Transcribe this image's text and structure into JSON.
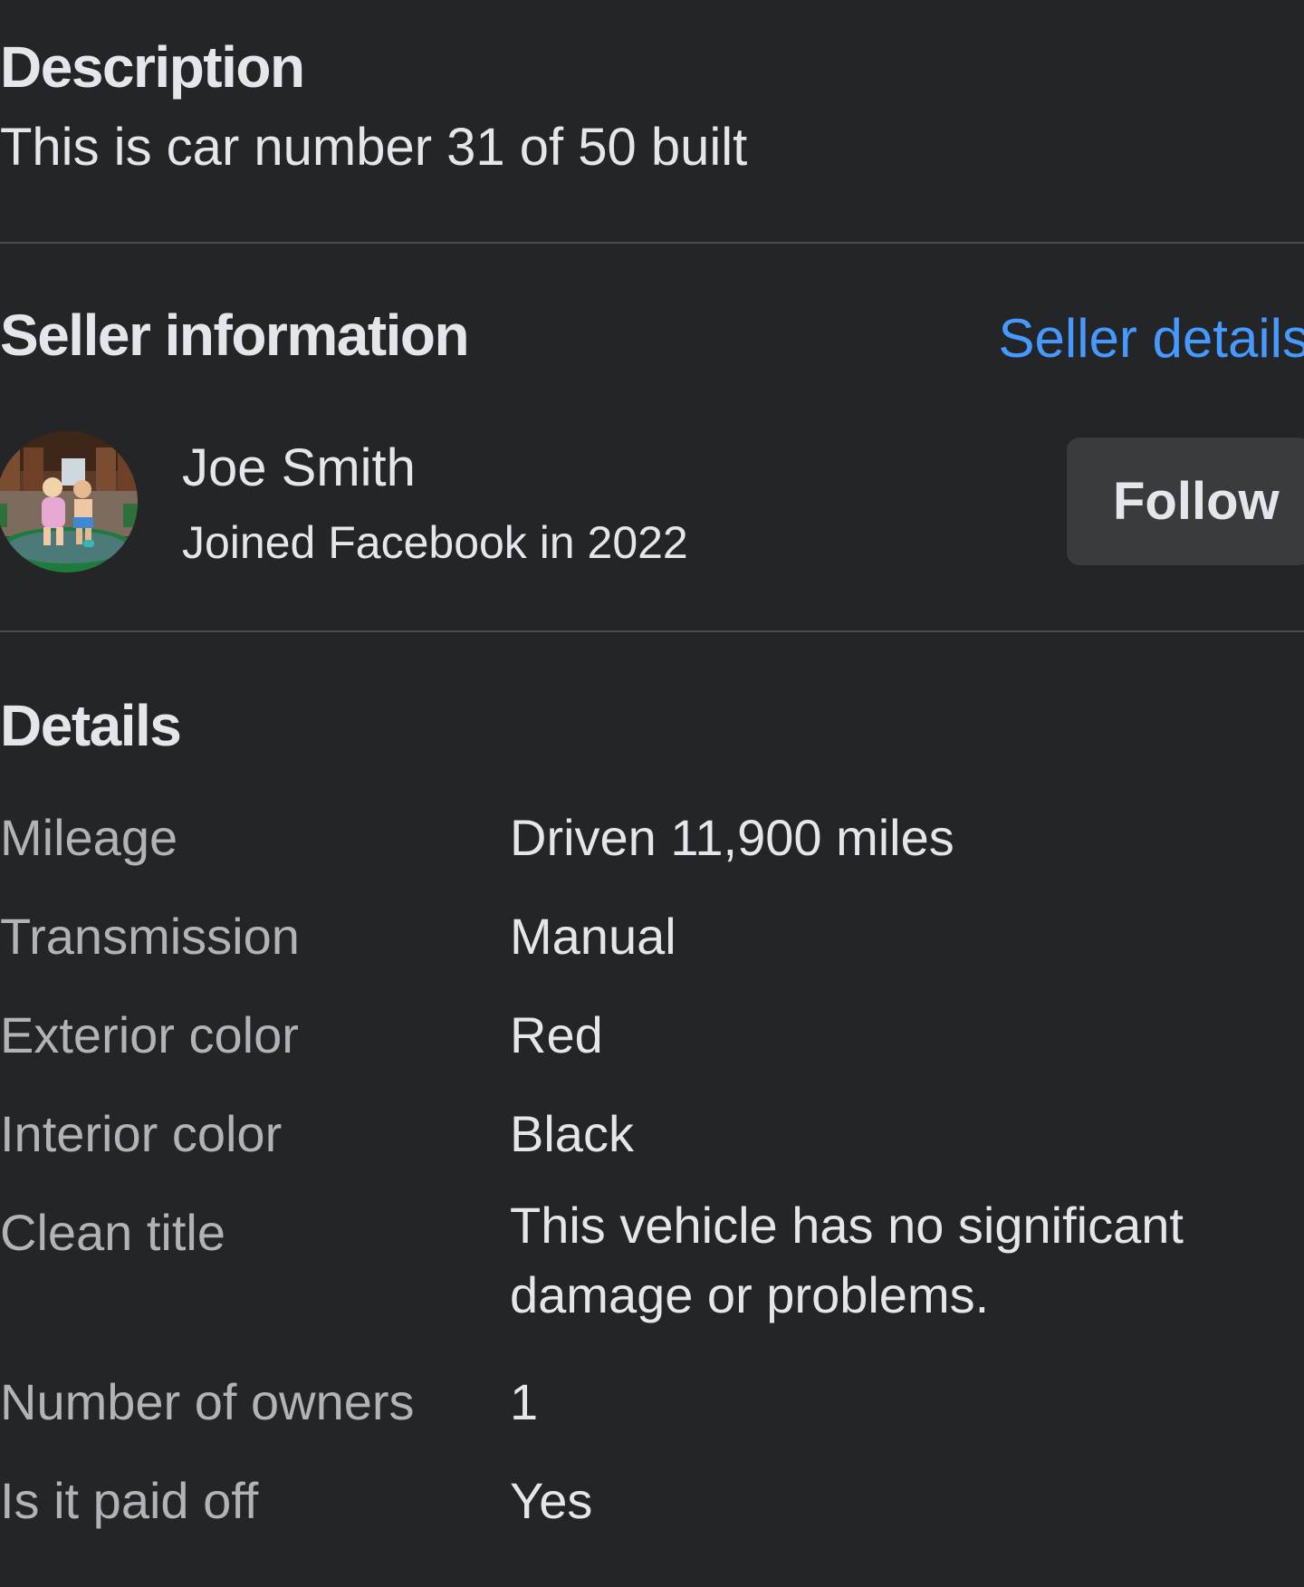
{
  "description": {
    "title": "Description",
    "text": "This is car number 31 of 50 built"
  },
  "seller": {
    "title": "Seller information",
    "details_link": "Seller details",
    "name": "Joe Smith",
    "joined": "Joined Facebook in 2022",
    "follow_label": "Follow"
  },
  "details": {
    "title": "Details",
    "rows": [
      {
        "label": "Mileage",
        "value": "Driven 11,900 miles"
      },
      {
        "label": "Transmission",
        "value": "Manual"
      },
      {
        "label": "Exterior color",
        "value": "Red"
      },
      {
        "label": "Interior color",
        "value": "Black"
      },
      {
        "label": "Clean title",
        "value": "This vehicle has no significant damage or problems."
      },
      {
        "label": "Number of owners",
        "value": "1"
      },
      {
        "label": "Is it paid off",
        "value": "Yes"
      }
    ]
  },
  "colors": {
    "background": "#242526",
    "text_primary": "#e4e6eb",
    "text_secondary": "#b0b3b8",
    "link": "#4599ff",
    "button_bg": "#3a3b3c",
    "divider": "#4a4b4d"
  }
}
